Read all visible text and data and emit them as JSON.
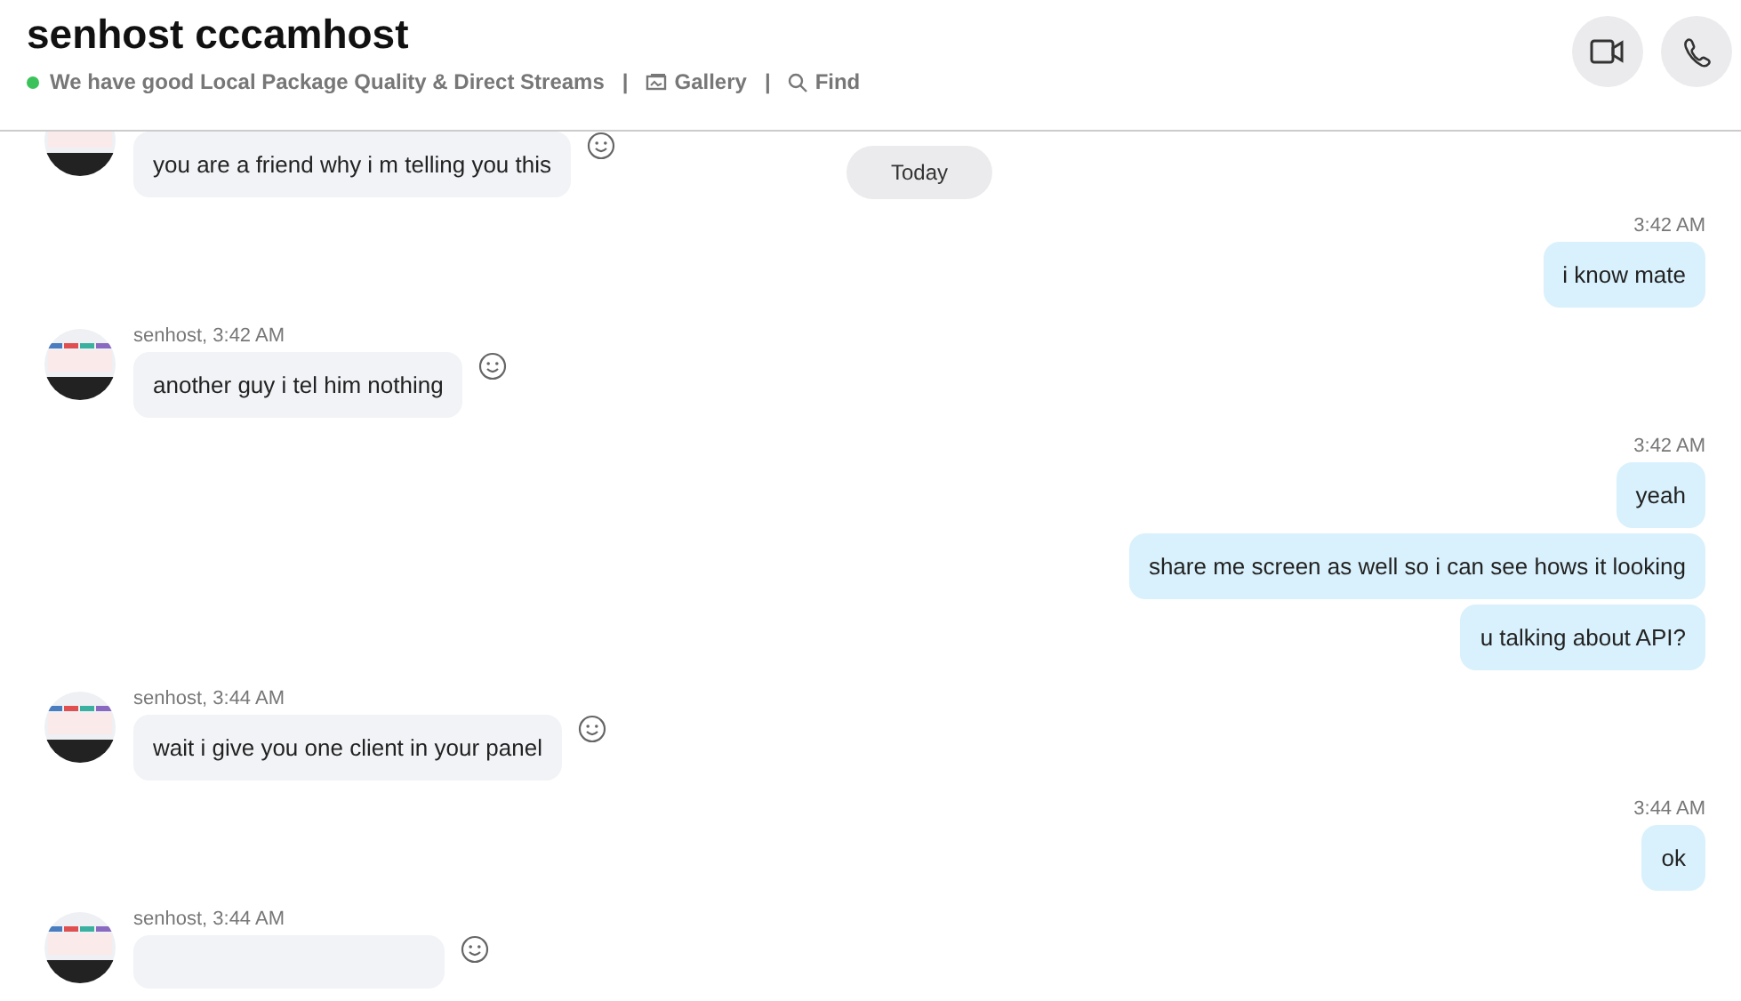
{
  "header": {
    "title": "senhost cccamhost",
    "online": true,
    "status": "We have good Local Package Quality & Direct Streams",
    "links": [
      {
        "kind": "gallery",
        "separator": "|",
        "label": "Gallery"
      },
      {
        "kind": "find",
        "separator": "|",
        "label": "Find"
      }
    ],
    "buttons": [
      {
        "kind": "video"
      },
      {
        "kind": "call"
      }
    ]
  },
  "date_pill": "Today",
  "groups": [
    {
      "kind": "incoming",
      "messages": [
        "you are a friend why i m telling you this"
      ]
    },
    {
      "kind": "outgoing",
      "time": "3:42 AM",
      "messages": [
        "i know mate"
      ]
    },
    {
      "kind": "incoming",
      "meta": "senhost, 3:42 AM",
      "messages": [
        "another guy i tel him nothing"
      ]
    },
    {
      "kind": "outgoing",
      "time": "3:42 AM",
      "messages": [
        "yeah",
        "share me screen as well so i can see hows it looking",
        "u talking about API?"
      ]
    },
    {
      "kind": "incoming",
      "meta": "senhost, 3:44 AM",
      "messages": [
        "wait i give you one client in your panel"
      ]
    },
    {
      "kind": "outgoing",
      "time": "3:44 AM",
      "messages": [
        "ok"
      ]
    },
    {
      "kind": "incoming",
      "meta": "senhost, 3:44 AM"
    }
  ]
}
